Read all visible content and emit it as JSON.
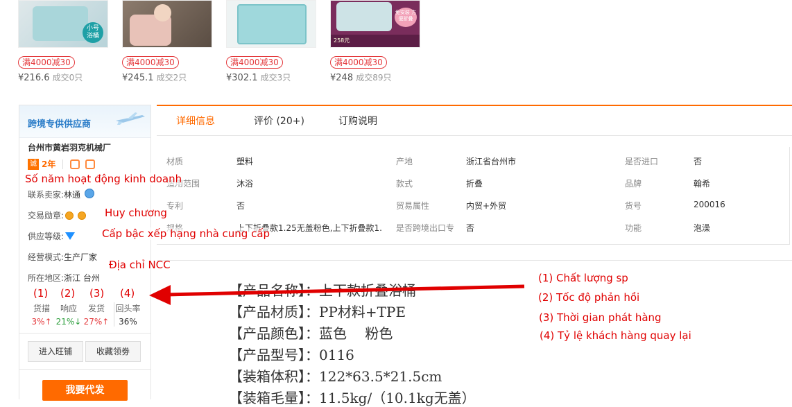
{
  "products": [
    {
      "tag": "满4000减30",
      "price": "¥216.6",
      "sold": "成交0只",
      "badge": "小号\n浴桶"
    },
    {
      "tag": "满4000减30",
      "price": "¥245.1",
      "sold": "成交2只"
    },
    {
      "tag": "满4000减30",
      "price": "¥302.1",
      "sold": "成交3只"
    },
    {
      "tag": "满4000减30",
      "price": "¥248",
      "sold": "成交89只",
      "badge": "免安装 方便折叠",
      "promo": "258元"
    }
  ],
  "supplier": {
    "header": "跨境专供供应商",
    "name": "台州市黄岩羽克机械厂",
    "years": "2年",
    "contact_label": "联系卖家:",
    "contact_value": "林通",
    "medal_label": "交易勋章:",
    "level_label": "供应等级:",
    "mode_label": "经营模式:",
    "mode_value": "生产厂家",
    "region_label": "所在地区:",
    "region_value": "浙江 台州",
    "stats": [
      {
        "key": "货描",
        "value": "3%↑",
        "trend": "up"
      },
      {
        "key": "响应",
        "value": "21%↓",
        "trend": "down"
      },
      {
        "key": "发货",
        "value": "27%↑",
        "trend": "up"
      },
      {
        "key": "回头率",
        "value": "36%",
        "trend": "none"
      }
    ],
    "btn_store": "进入旺铺",
    "btn_fav": "收藏领劵",
    "btn_buy": "我要代发"
  },
  "tabs": [
    "详细信息",
    "评价 (20+)",
    "订购说明"
  ],
  "attributes": [
    [
      "材质",
      "塑料",
      "产地",
      "浙江省台州市",
      "是否进口",
      "否"
    ],
    [
      "适用范围",
      "沐浴",
      "款式",
      "折叠",
      "品牌",
      "翰希"
    ],
    [
      "专利",
      "否",
      "贸易属性",
      "内贸+外贸",
      "货号",
      "200016"
    ],
    [
      "规格",
      "上下折叠款1.25无盖粉色,上下折叠款1.",
      "是否跨境出口专",
      "否",
      "功能",
      "泡澡"
    ]
  ],
  "description": [
    "【产品名称】：上下款折叠浴桶",
    "【产品材质】：PP材料+TPE",
    "【产品颜色】：蓝色　 粉色",
    "【产品型号】：0116",
    "【装箱体积】：122*63.5*21.5cm",
    "【装箱毛量】：11.5kg/（10.1kg无盖）"
  ],
  "annotations": {
    "years": "Số năm hoạt động kinh doanh",
    "medal": "Huy chương",
    "level": "Cấp bậc xếp hạng nhà cung cấp",
    "address": "Địa chỉ NCC",
    "n1": "(1)",
    "n2": "(2)",
    "n3": "(3)",
    "n4": "(4)",
    "r1": "(1) Chất lượng sp",
    "r2": "(2) Tốc độ phản hồi",
    "r3": "(3) Thời gian phát hàng",
    "r4": "(4) Tỷ lệ khách hàng quay lại"
  },
  "colors": {
    "accent": "#ff6a00",
    "annotation": "#e00000",
    "link": "#2a7cc8"
  }
}
